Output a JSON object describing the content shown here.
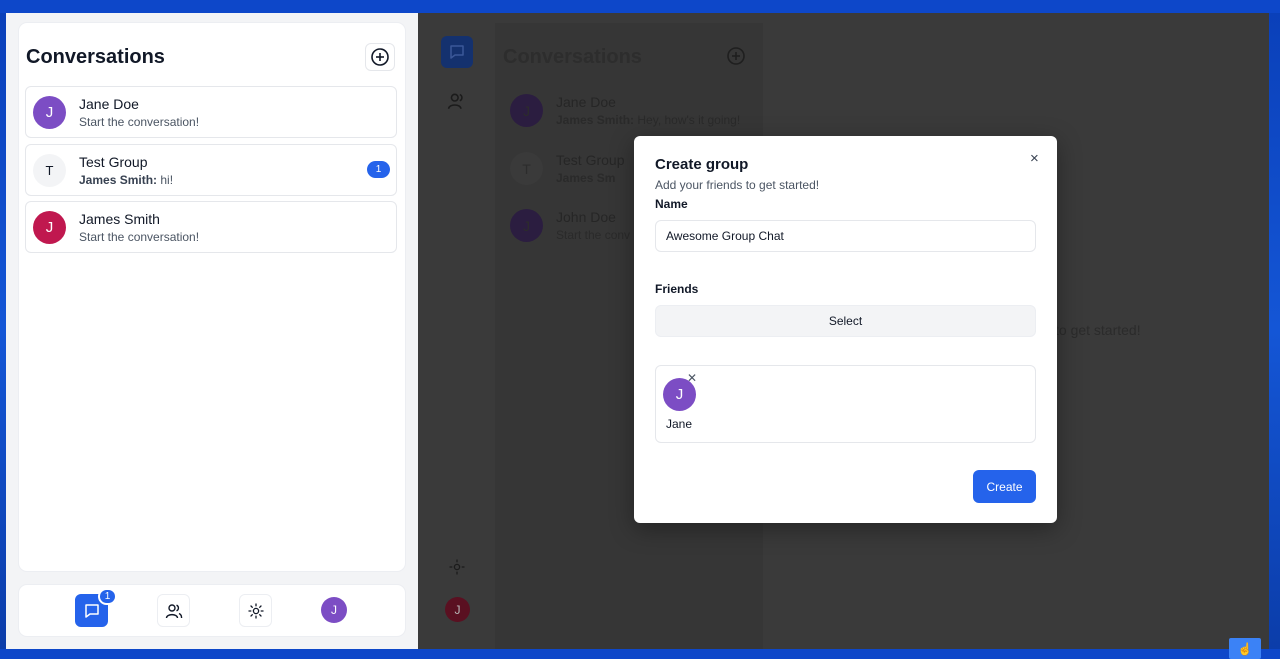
{
  "left": {
    "title": "Conversations",
    "conversations": [
      {
        "initial": "J",
        "name": "Jane Doe",
        "sender": "",
        "message": "Start the conversation!",
        "avatar_color": "#7c4dc4"
      },
      {
        "initial": "T",
        "name": "Test Group",
        "sender": "James Smith:",
        "message": "hi!",
        "avatar_color": "#f3f4f6",
        "unread": "1"
      },
      {
        "initial": "J",
        "name": "James Smith",
        "sender": "",
        "message": "Start the conversation!",
        "avatar_color": "#c0184f"
      }
    ],
    "nav": {
      "chat_badge": "1",
      "avatar_initial": "J"
    }
  },
  "background": {
    "title": "Conversations",
    "conversations": [
      {
        "initial": "J",
        "name": "Jane Doe",
        "sender": "James Smith:",
        "message": "Hey, how's it going!"
      },
      {
        "initial": "T",
        "name": "Test Group",
        "sender": "James Sm",
        "message": ""
      },
      {
        "initial": "J",
        "name": "John Doe",
        "sender": "",
        "message": "Start the conv"
      }
    ],
    "hint": "to get started!",
    "avatar_initial": "J"
  },
  "modal": {
    "title": "Create group",
    "description": "Add your friends to get started!",
    "name_label": "Name",
    "name_value": "Awesome Group Chat",
    "friends_label": "Friends",
    "select_label": "Select",
    "selected_friends": [
      {
        "initial": "J",
        "name": "Jane"
      }
    ],
    "close_symbol": "×",
    "create_label": "Create"
  },
  "colors": {
    "accent": "#2563eb",
    "modal_bg": "#ffffff",
    "overlay": "#3a3a3a"
  }
}
